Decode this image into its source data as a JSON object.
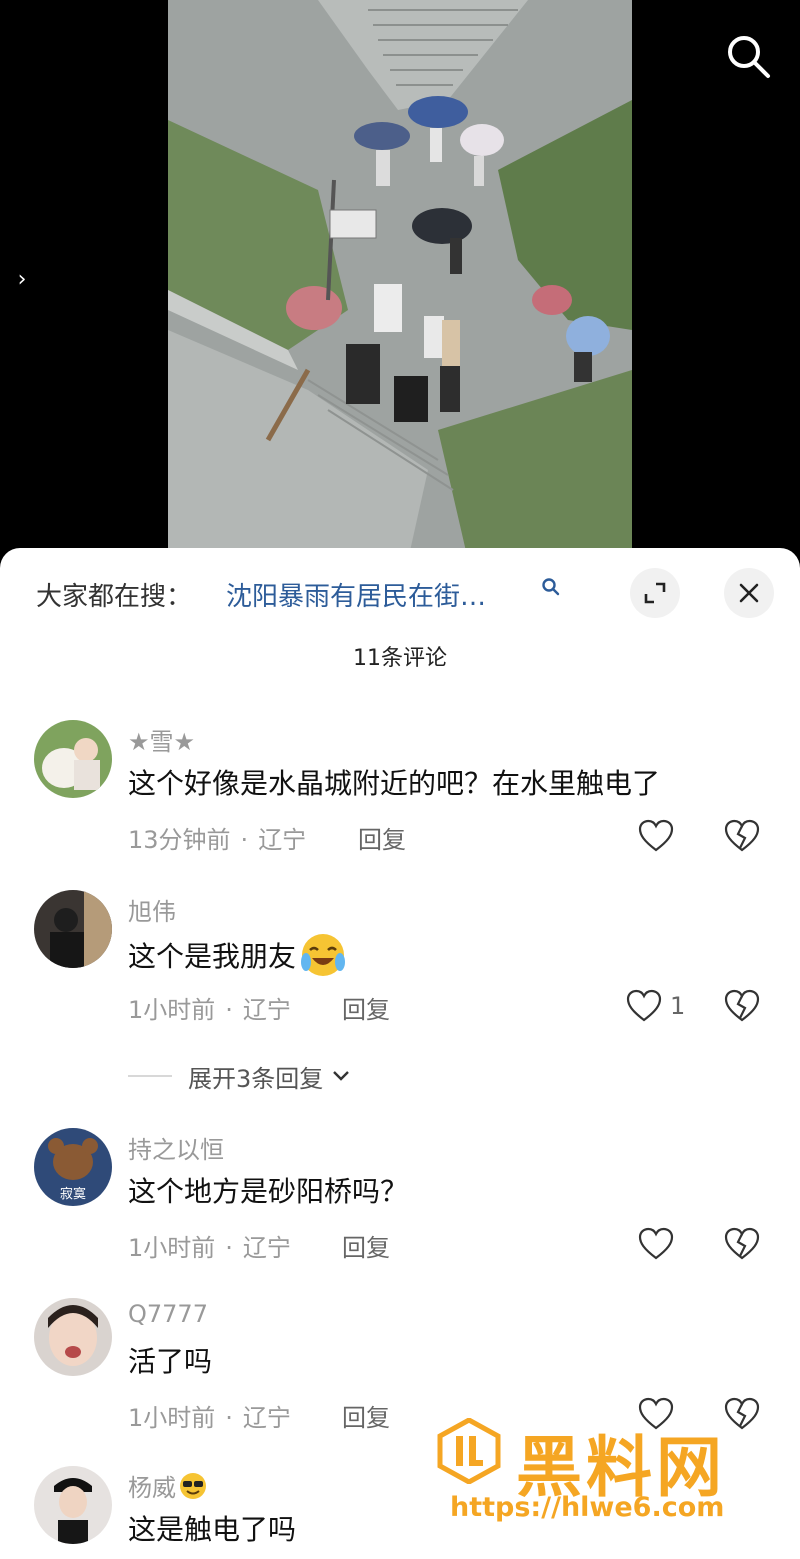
{
  "search_bar": {
    "label": "大家都在搜：",
    "query": "沈阳暴雨有居民在街…"
  },
  "comment_count": "11条评论",
  "comments": [
    {
      "username": "★雪★",
      "text": "这个好像是水晶城附近的吧？在水里触电了",
      "time": "13分钟前",
      "location": "辽宁",
      "reply_label": "回复",
      "likes": ""
    },
    {
      "username": "旭伟",
      "text": "这个是我朋友",
      "emoji": "crying-laughing-emoji",
      "time": "1小时前",
      "location": "辽宁",
      "reply_label": "回复",
      "likes": "1"
    },
    {
      "username": "持之以恒",
      "text": "这个地方是砂阳桥吗？",
      "time": "1小时前",
      "location": "辽宁",
      "reply_label": "回复",
      "likes": "",
      "avatar_text": "寂寞"
    },
    {
      "username": "Q7777",
      "text": "活了吗",
      "time": "1小时前",
      "location": "辽宁",
      "reply_label": "回复",
      "likes": ""
    },
    {
      "username": "杨威",
      "text": "这是触电了吗",
      "time": "",
      "location": "",
      "reply_label": "",
      "likes": ""
    }
  ],
  "expand_replies": "展开3条回复",
  "meta_separator": "·",
  "watermark": {
    "title": "黑料网",
    "url": "https://hlwe6.com"
  },
  "icons": {
    "top_search": "search-icon",
    "side_arrow": "chevron-right-icon",
    "expand": "expand-icon",
    "close": "close-icon",
    "like": "heart-outline-icon",
    "dislike": "broken-heart-icon"
  },
  "colors": {
    "link": "#2d5c99",
    "watermark": "#f5a623",
    "sheet_bg": "#ffffff"
  }
}
